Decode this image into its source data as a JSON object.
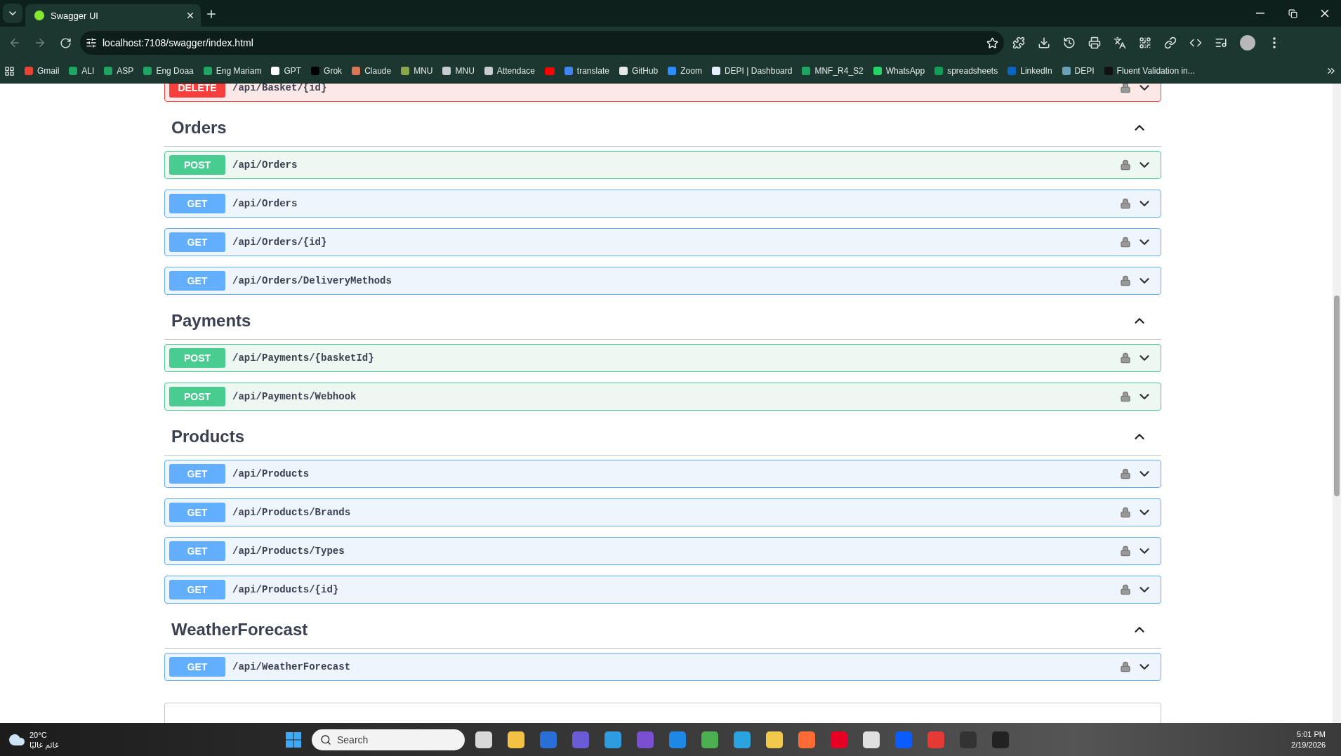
{
  "browser": {
    "tabs": [
      {
        "title": "Swagger UI",
        "selected": true
      }
    ],
    "address": "localhost:7108/swagger/index.html",
    "bookmarks": [
      {
        "label": "Gmail",
        "color": "#ea4335"
      },
      {
        "label": "ALI",
        "color": "#1fa463"
      },
      {
        "label": "ASP",
        "color": "#1fa463"
      },
      {
        "label": "Eng Doaa",
        "color": "#1fa463"
      },
      {
        "label": "Eng Mariam",
        "color": "#1fa463"
      },
      {
        "label": "GPT",
        "color": "#ffffff"
      },
      {
        "label": "Grok",
        "color": "#000000"
      },
      {
        "label": "Claude",
        "color": "#d97757"
      },
      {
        "label": "MNU",
        "color": "#8aa64b"
      },
      {
        "label": "MNU",
        "color": "#c8ccd0"
      },
      {
        "label": "Attendace",
        "color": "#c8ccd0"
      },
      {
        "color": "#ff0000"
      },
      {
        "label": "translate",
        "color": "#4285f4"
      },
      {
        "label": "GitHub",
        "color": "#e8e8e8"
      },
      {
        "label": "Zoom",
        "color": "#2d8cff"
      },
      {
        "label": "DEPI | Dashboard",
        "color": "#e8eefc"
      },
      {
        "label": "MNF_R4_S2",
        "color": "#1fa463"
      },
      {
        "label": "WhatsApp",
        "color": "#25d366"
      },
      {
        "label": "spreadsheets",
        "color": "#0f9d58"
      },
      {
        "label": "LinkedIn",
        "color": "#0a66c2"
      },
      {
        "label": "DEPI",
        "color": "#6a9fb5"
      },
      {
        "label": "Fluent Validation in...",
        "color": "#111111"
      }
    ]
  },
  "page": {
    "partial_operation": {
      "kind": "delete",
      "method": "DELETE",
      "path": "/api/Basket/{id}",
      "expanded": false
    },
    "sections": [
      {
        "name": "Orders",
        "expanded": true,
        "operations": [
          {
            "kind": "post",
            "method": "POST",
            "path": "/api/Orders",
            "expanded": false
          },
          {
            "kind": "get",
            "method": "GET",
            "path": "/api/Orders",
            "expanded": false
          },
          {
            "kind": "get",
            "method": "GET",
            "path": "/api/Orders/{id}",
            "expanded": false
          },
          {
            "kind": "get",
            "method": "GET",
            "path": "/api/Orders/DeliveryMethods",
            "expanded": false
          }
        ]
      },
      {
        "name": "Payments",
        "expanded": true,
        "operations": [
          {
            "kind": "post",
            "method": "POST",
            "path": "/api/Payments/{basketId}",
            "expanded": false
          },
          {
            "kind": "post",
            "method": "POST",
            "path": "/api/Payments/Webhook",
            "expanded": false
          }
        ]
      },
      {
        "name": "Products",
        "expanded": true,
        "operations": [
          {
            "kind": "get",
            "method": "GET",
            "path": "/api/Products",
            "expanded": false
          },
          {
            "kind": "get",
            "method": "GET",
            "path": "/api/Products/Brands",
            "expanded": false
          },
          {
            "kind": "get",
            "method": "GET",
            "path": "/api/Products/Types",
            "expanded": false
          },
          {
            "kind": "get",
            "method": "GET",
            "path": "/api/Products/{id}",
            "expanded": false
          }
        ]
      },
      {
        "name": "WeatherForecast",
        "expanded": true,
        "operations": [
          {
            "kind": "get",
            "method": "GET",
            "path": "/api/WeatherForecast",
            "expanded": false
          }
        ]
      }
    ]
  },
  "taskbar": {
    "weather": {
      "temperature": "20°C",
      "condition": "غائم غالبًا"
    },
    "search": {
      "placeholder": "Search"
    },
    "apps": [
      {
        "color": "#d9d9d9"
      },
      {
        "color": "#f4c242"
      },
      {
        "color": "#2a6fd6"
      },
      {
        "color": "#6b5bd6"
      },
      {
        "color": "#2f9be0"
      },
      {
        "color": "#7a4fd0"
      },
      {
        "color": "#1e88e5"
      },
      {
        "color": "#4caf50"
      },
      {
        "color": "#2aa3de"
      },
      {
        "color": "#f2c94c"
      },
      {
        "color": "#ff6b35"
      },
      {
        "color": "#e60023"
      },
      {
        "color": "#e0e0e0"
      },
      {
        "color": "#0b5cff"
      },
      {
        "color": "#e53935"
      },
      {
        "color": "#333333"
      },
      {
        "color": "#222222"
      }
    ],
    "clock": {
      "time": "5:01 PM",
      "date": "2/19/2026"
    }
  }
}
